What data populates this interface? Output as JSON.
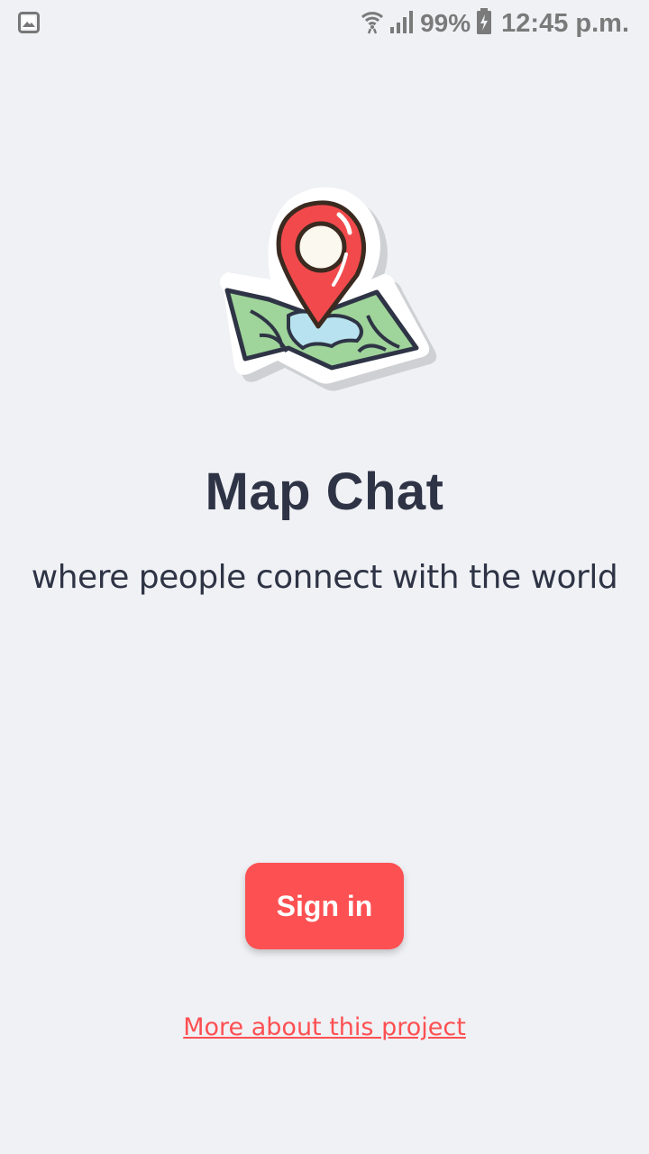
{
  "status_bar": {
    "notification_icon": "image-icon",
    "wifi_icon": "wifi-icon",
    "signal_icon": "signal-icon",
    "battery_percent": "99%",
    "battery_icon": "battery-charging-icon",
    "time": "12:45 p.m."
  },
  "logo": {
    "icon": "map-pin-icon"
  },
  "app": {
    "title": "Map Chat",
    "tagline": "where people connect with the world"
  },
  "actions": {
    "sign_in_label": "Sign in",
    "more_link": "More about this project"
  },
  "colors": {
    "background": "#f0f1f5",
    "accent": "#fd5052",
    "text": "#2e3445"
  }
}
